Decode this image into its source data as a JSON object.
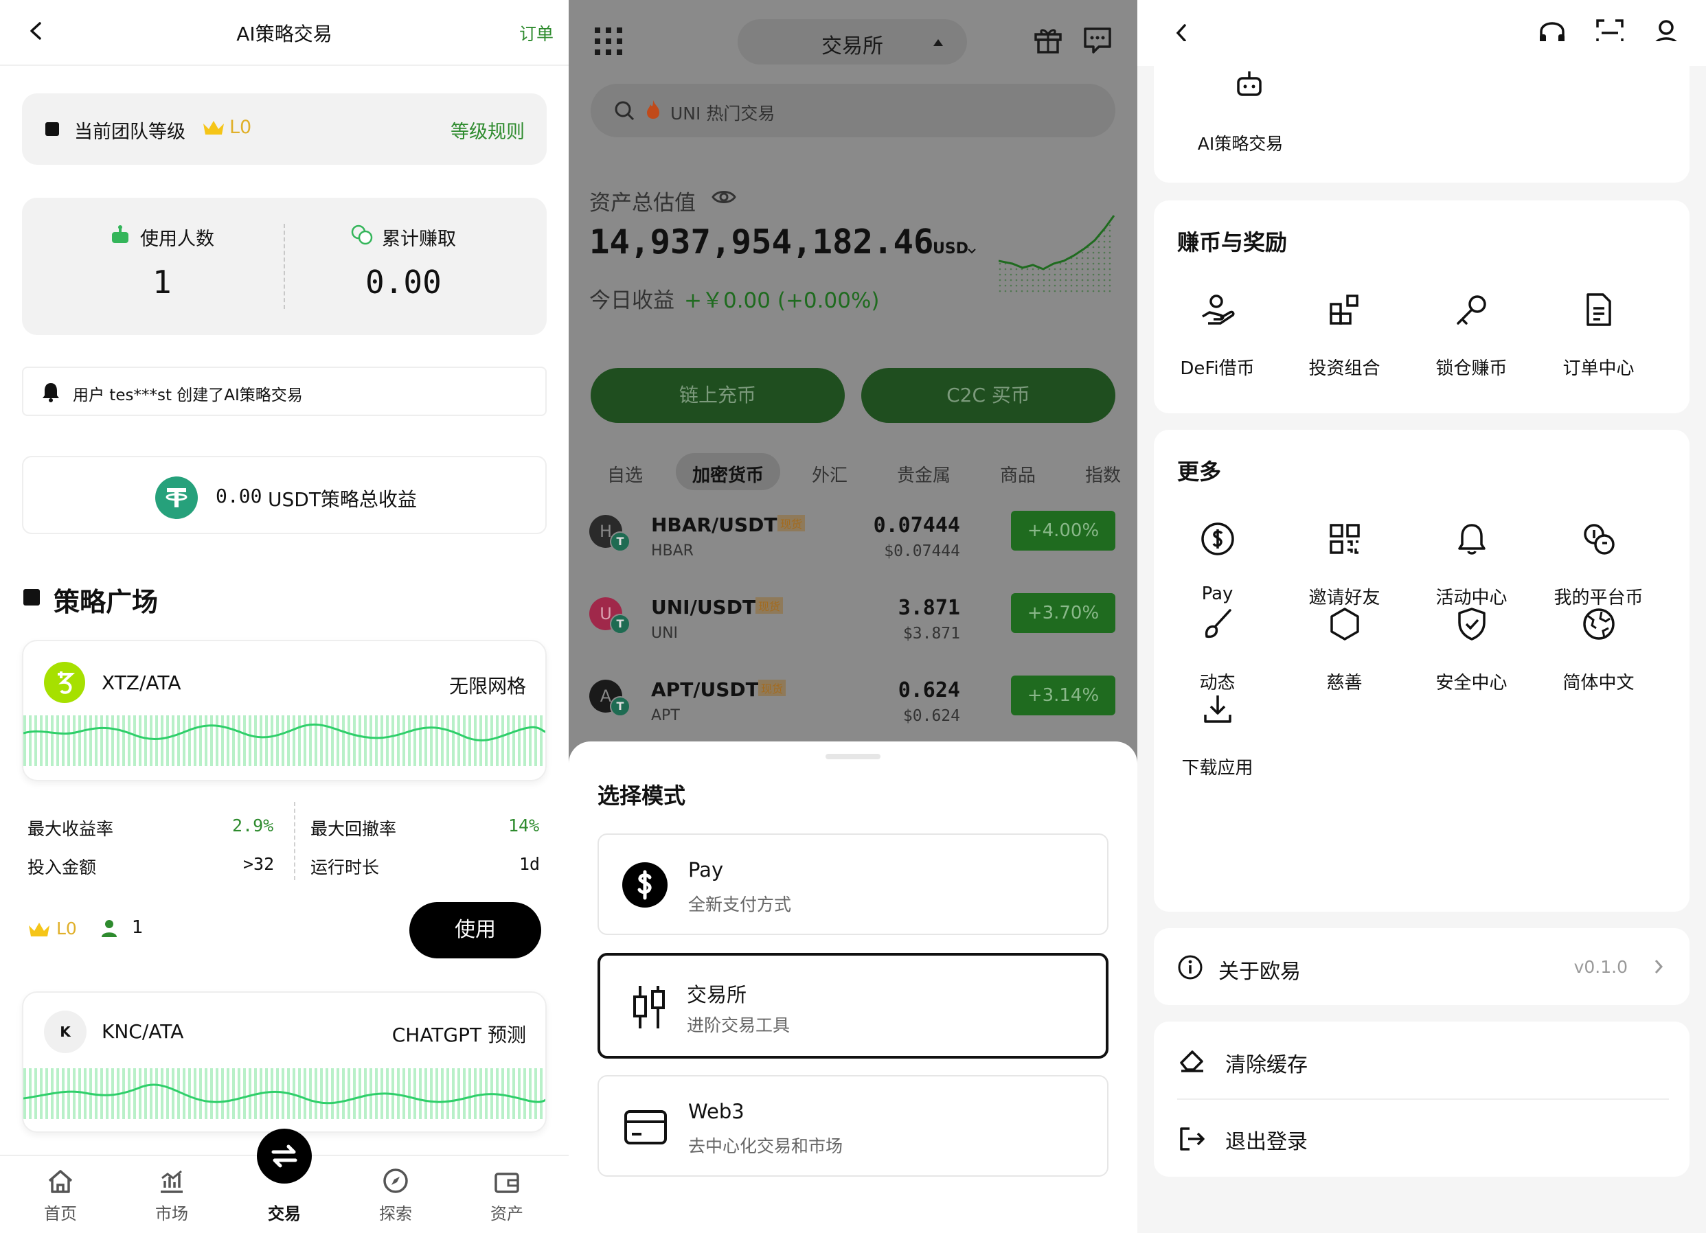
{
  "panel1": {
    "header": {
      "title": "AI策略交易",
      "right": "订单"
    },
    "team": {
      "label": "当前团队等级",
      "level": "L0",
      "rules": "等级规则"
    },
    "stats": {
      "users_label": "使用人数",
      "users_value": "1",
      "earned_label": "累计赚取",
      "earned_value": "0.00"
    },
    "notice": "用户 tes***st 创建了AI策略交易",
    "total": {
      "value": "0.00",
      "label": "USDT策略总收益"
    },
    "plaza_title": "策略广场",
    "strategy1": {
      "pair": "XTZ/ATA",
      "type": "无限网格",
      "max_yield_label": "最大收益率",
      "max_yield": "2.9%",
      "max_drawdown_label": "最大回撤率",
      "max_drawdown": "14%",
      "invest_label": "投入金额",
      "invest": ">32",
      "runtime_label": "运行时长",
      "runtime": "1d",
      "level": "L0",
      "users": "1",
      "use_btn": "使用"
    },
    "strategy2": {
      "pair": "KNC/ATA",
      "type": "CHATGPT 预测",
      "logo_letter": "K"
    },
    "bottom_nav": [
      "首页",
      "市场",
      "交易",
      "探索",
      "资产"
    ]
  },
  "panel2": {
    "mode_selector": "交易所",
    "search_placeholder": "UNI 热门交易",
    "assets_label": "资产总估值",
    "assets_value": "14,937,954,182.46",
    "assets_unit": "USD",
    "today_label": "今日收益",
    "today_value": "+￥0.00 (+0.00%)",
    "btn_deposit": "链上充币",
    "btn_c2c": "C2C 买币",
    "tabs": [
      "自选",
      "加密货币",
      "外汇",
      "贵金属",
      "商品",
      "指数"
    ],
    "active_tab": "加密货币",
    "markets": [
      {
        "pair": "HBAR/USDT",
        "tag": "现货",
        "base": "HBAR",
        "price": "0.07444",
        "usd": "$0.07444",
        "change": "+4.00%",
        "logo": "H"
      },
      {
        "pair": "UNI/USDT",
        "tag": "现货",
        "base": "UNI",
        "price": "3.871",
        "usd": "$3.871",
        "change": "+3.70%",
        "logo": "U"
      },
      {
        "pair": "APT/USDT",
        "tag": "现货",
        "base": "APT",
        "price": "0.624",
        "usd": "$0.624",
        "change": "+3.14%",
        "logo": "A"
      }
    ],
    "sheet": {
      "title": "选择模式",
      "options": [
        {
          "title": "Pay",
          "desc": "全新支付方式"
        },
        {
          "title": "交易所",
          "desc": "进阶交易工具"
        },
        {
          "title": "Web3",
          "desc": "去中心化交易和市场"
        }
      ]
    }
  },
  "panel3": {
    "top_item": "AI策略交易",
    "earn_title": "赚币与奖励",
    "earn_items": [
      "DeFi借币",
      "投资组合",
      "锁仓赚币",
      "订单中心"
    ],
    "more_title": "更多",
    "more_items": [
      "Pay",
      "邀请好友",
      "活动中心",
      "我的平台币",
      "动态",
      "慈善",
      "安全中心",
      "简体中文",
      "下载应用"
    ],
    "about": {
      "label": "关于欧易",
      "version": "v0.1.0"
    },
    "clear_cache": "清除缓存",
    "logout": "退出登录"
  },
  "colors": {
    "accent_green": "#2e8b2e",
    "up_green": "#33a33a",
    "gold": "#f5c518",
    "tether": "#26a17b"
  }
}
